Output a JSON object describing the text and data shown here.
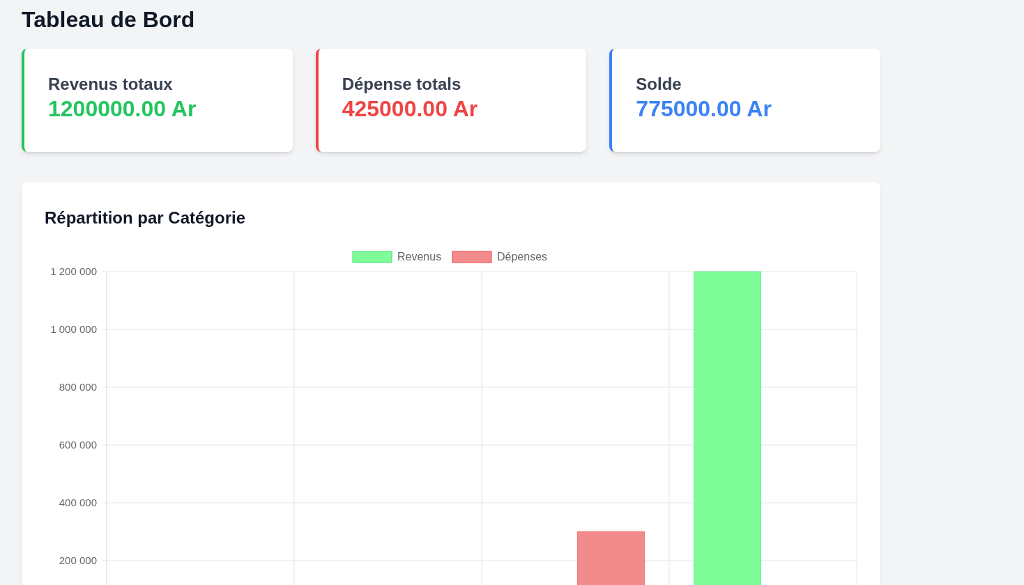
{
  "page_title": "Tableau de Bord",
  "summary_cards": [
    {
      "label": "Revenus totaux",
      "value": "1200000.00 Ar",
      "color": "#22c55e"
    },
    {
      "label": "Dépense totals",
      "value": "425000.00 Ar",
      "color": "#ef4444"
    },
    {
      "label": "Solde",
      "value": "775000.00 Ar",
      "color": "#3b82f6"
    }
  ],
  "chart_card": {
    "title": "Répartition par Catégorie",
    "chart_data": {
      "type": "bar",
      "categories": [
        null,
        null,
        null,
        null
      ],
      "series": [
        {
          "name": "Revenus",
          "color": "#7dfc97",
          "values": [
            null,
            null,
            null,
            1200000
          ]
        },
        {
          "name": "Dépenses",
          "color": "#f28b8b",
          "values": [
            null,
            null,
            300000,
            null
          ]
        }
      ],
      "yticks": [
        {
          "value": 200000,
          "label": "200 000"
        },
        {
          "value": 400000,
          "label": "400 000"
        },
        {
          "value": 600000,
          "label": "600 000"
        },
        {
          "value": 800000,
          "label": "800 000"
        },
        {
          "value": 1000000,
          "label": "1 000 000"
        },
        {
          "value": 1200000,
          "label": "1 200 000"
        }
      ],
      "ylim": [
        0,
        1200000
      ],
      "grid": true,
      "legend": true
    }
  }
}
